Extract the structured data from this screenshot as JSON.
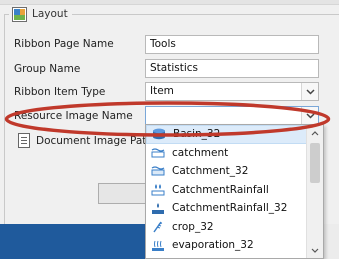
{
  "group": {
    "title": "Layout"
  },
  "fields": {
    "ribbon_page_name": {
      "label": "Ribbon Page Name",
      "value": "Tools"
    },
    "group_name": {
      "label": "Group Name",
      "value": "Statistics"
    },
    "ribbon_item_type": {
      "label": "Ribbon Item Type",
      "value": "Item"
    },
    "resource_image_name": {
      "label": "Resource Image Name",
      "value": ""
    },
    "document_image_path": {
      "label": "Document Image Path"
    }
  },
  "dropdown": {
    "items": [
      {
        "label": "Basin_32",
        "icon": "basin-icon",
        "selected": true
      },
      {
        "label": "catchment",
        "icon": "catchment-icon",
        "selected": false
      },
      {
        "label": "Catchment_32",
        "icon": "catchment-icon",
        "selected": false
      },
      {
        "label": "CatchmentRainfall",
        "icon": "rainfall-icon",
        "selected": false
      },
      {
        "label": "CatchmentRainfall_32",
        "icon": "rainfall-icon",
        "selected": false
      },
      {
        "label": "crop_32",
        "icon": "crop-icon",
        "selected": false
      },
      {
        "label": "evaporation_32",
        "icon": "evaporation-icon",
        "selected": false
      }
    ]
  },
  "colors": {
    "highlight_ellipse": "#c0392b",
    "selected_item_bg": "#dcebfa",
    "bottom_bar": "#1f5a9c"
  }
}
